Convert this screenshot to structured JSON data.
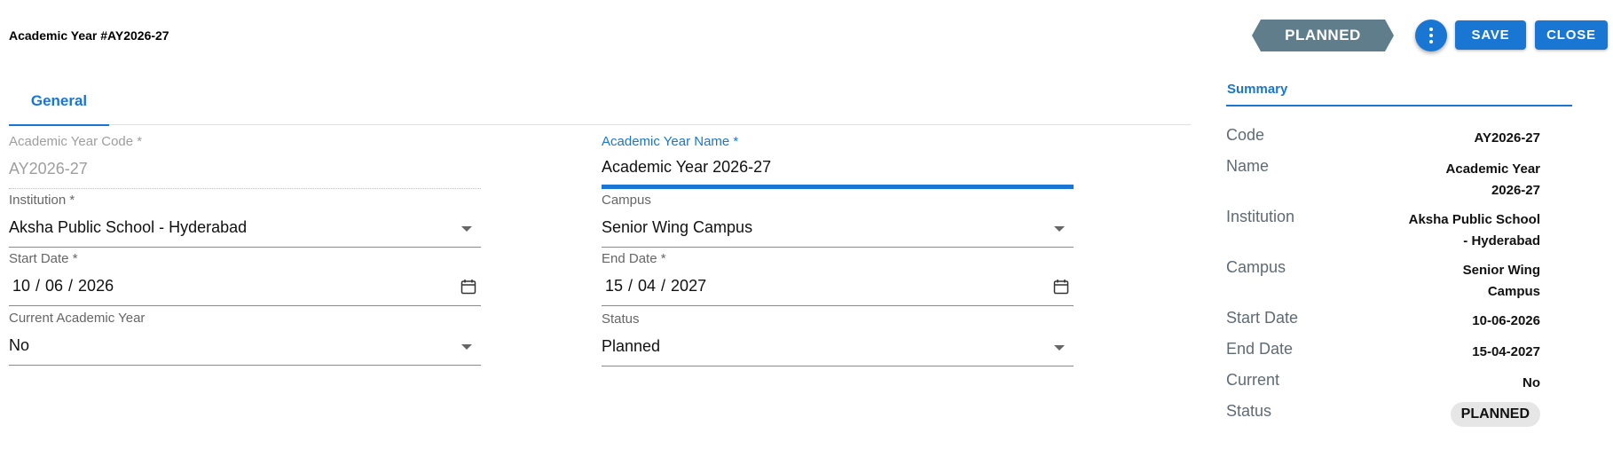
{
  "header": {
    "title": "Academic Year #AY2026-27",
    "status_ribbon": "PLANNED",
    "save_label": "SAVE",
    "close_label": "CLOSE"
  },
  "tabs": [
    {
      "label": "General"
    }
  ],
  "form": {
    "code": {
      "label": "Academic Year Code *",
      "value": "AY2026-27"
    },
    "name": {
      "label": "Academic Year Name *",
      "value": "Academic Year 2026-27"
    },
    "institution": {
      "label": "Institution *",
      "value": "Aksha Public School - Hyderabad"
    },
    "campus": {
      "label": "Campus",
      "value": "Senior Wing Campus"
    },
    "start_date": {
      "label": "Start Date *",
      "value": "10 / 06 / 2026"
    },
    "end_date": {
      "label": "End Date *",
      "value": "15 / 04 / 2027"
    },
    "current": {
      "label": "Current Academic Year",
      "value": "No"
    },
    "status": {
      "label": "Status",
      "value": "Planned"
    }
  },
  "summary": {
    "title": "Summary",
    "rows": [
      {
        "label": "Code",
        "value": "AY2026-27"
      },
      {
        "label": "Name",
        "value_lines": [
          "Academic Year",
          "2026-27"
        ]
      },
      {
        "label": "Institution",
        "value_lines": [
          "Aksha Public School",
          "- Hyderabad"
        ]
      },
      {
        "label": "Campus",
        "value_lines": [
          "Senior Wing",
          "Campus"
        ]
      },
      {
        "label": "Start Date",
        "value": "10-06-2026"
      },
      {
        "label": "End Date",
        "value": "15-04-2027"
      },
      {
        "label": "Current",
        "value": "No"
      },
      {
        "label": "Status",
        "value": "PLANNED"
      }
    ]
  },
  "colors": {
    "primary": "#1976d2",
    "ribbon": "#607d8b"
  },
  "icons": [
    "more-vert-icon",
    "calendar-icon",
    "dropdown-caret-icon"
  ]
}
